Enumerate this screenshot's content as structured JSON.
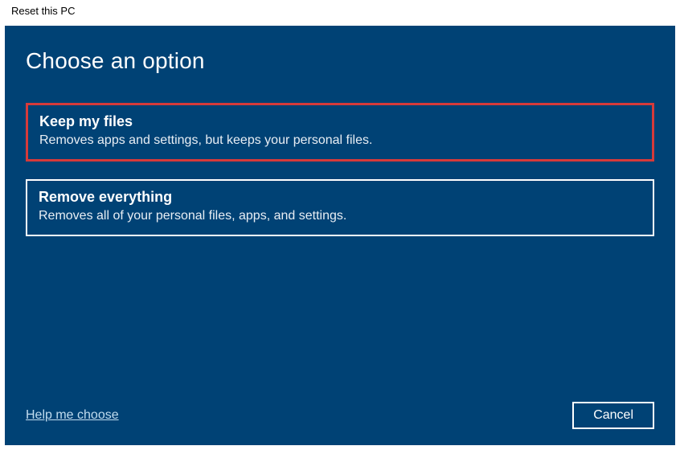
{
  "window": {
    "title": "Reset this PC"
  },
  "heading": "Choose an option",
  "options": [
    {
      "title": "Keep my files",
      "description": "Removes apps and settings, but keeps your personal files.",
      "highlighted": true
    },
    {
      "title": "Remove everything",
      "description": "Removes all of your personal files, apps, and settings.",
      "highlighted": false
    }
  ],
  "footer": {
    "help_label": "Help me choose",
    "cancel_label": "Cancel"
  }
}
